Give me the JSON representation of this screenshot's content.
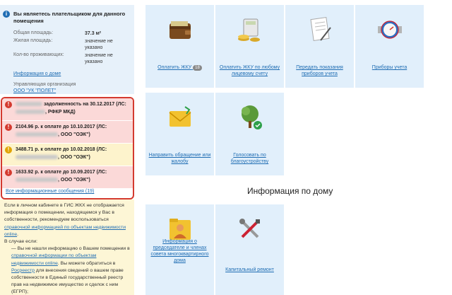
{
  "info": {
    "title": "Вы являетесь плательщиком для данного помещения",
    "rows": [
      {
        "label": "Общая площадь:",
        "value": "37.3 м²"
      },
      {
        "label": "Жилая площадь:",
        "value": "значение не указано"
      },
      {
        "label": "Кол-во проживающих:",
        "value": "значение не указано"
      }
    ],
    "house_link": "Информация о доме",
    "org_label": "Управляющая организация",
    "org_link": "ООО \"УК \"ПОЛЕТ\""
  },
  "alerts": [
    {
      "type": "red",
      "line1": "задолженность на 30.12.2017 (ЛС:",
      "line2": ", РФКР МКД)"
    },
    {
      "type": "red",
      "line1": "2104.96 р. к оплате до 10.10.2017 (ЛС:",
      "line2": ", ООО \"ОЭК\")"
    },
    {
      "type": "yellow",
      "line1": "3488.71 р. к оплате до 10.02.2018 (ЛС:",
      "line2": ", ООО \"ОЭК\")"
    },
    {
      "type": "red",
      "line1": "1633.92 р. к оплате до 10.09.2017 (ЛС:",
      "line2": ", ООО \"ОЭК\")"
    }
  ],
  "all_messages": "Все информационные сообщения (19)",
  "note": {
    "p1_a": "Если в личном кабинете в ГИС ЖКХ не отображается информация о помещении, находящемся у Вас в собственности, рекомендуем воспользоваться ",
    "p1_link": "справочной информацией по объектам недвижимости online",
    "p1_b": ".",
    "p2": "В случае если:",
    "p3_a": "— Вы не нашли информацию о Вашем помещении в ",
    "p3_link": "справочной информации по объектам недвижимости online",
    "p3_b": ". Вы можете обратиться в ",
    "p3_link2": "Росреестр",
    "p3_c": " для внесения сведений о вашем праве собственности в Единый государственный реестр прав на недвижимое имущество и сделок с ним (ЕГРП);"
  },
  "tiles": {
    "pay": {
      "label": "Оплатить ЖКУ",
      "badge": "18"
    },
    "pay_account": {
      "label": "Оплатить ЖКУ по любому лицевому счету"
    },
    "meters_submit": {
      "label": "Передать показания приборов учета"
    },
    "meters": {
      "label": "Приборы учета"
    },
    "appeal": {
      "label": "Направить обращение или жалобу"
    },
    "vote": {
      "label": "Голосовать по благоустройству"
    },
    "chairman": {
      "label": "Информация о председателе и членах совета многоквартирного дома"
    },
    "repair": {
      "label": "Капитальный ремонт"
    }
  },
  "house_section_title": "Информация по дому",
  "colors": {
    "accent": "#1f6db3",
    "tile_bg": "#e1effb",
    "alert_red": "#fbd9d8",
    "alert_yellow": "#fdf3cc",
    "alert_border": "#d43a2f"
  }
}
